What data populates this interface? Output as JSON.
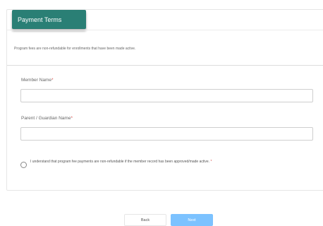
{
  "card": {
    "title": "Payment Terms",
    "notice": "Program fees are non-refundable for enrollments that have been made active."
  },
  "form": {
    "member_name": {
      "label": "Member Name",
      "required_mark": "*",
      "value": "",
      "placeholder": ""
    },
    "guardian_name": {
      "label": "Parent / Guardian Name",
      "required_mark": "*",
      "value": "",
      "placeholder": ""
    },
    "acknowledgement": {
      "text": "I understand that program fee payments are non-refundable if the member record has been approved/made active.",
      "required_mark": "*",
      "checked": false
    }
  },
  "actions": {
    "back_label": "Back",
    "next_label": "Next"
  },
  "colors": {
    "header": "#2a7f75",
    "primary_button": "#7cc2ff",
    "required": "#d9534f"
  }
}
